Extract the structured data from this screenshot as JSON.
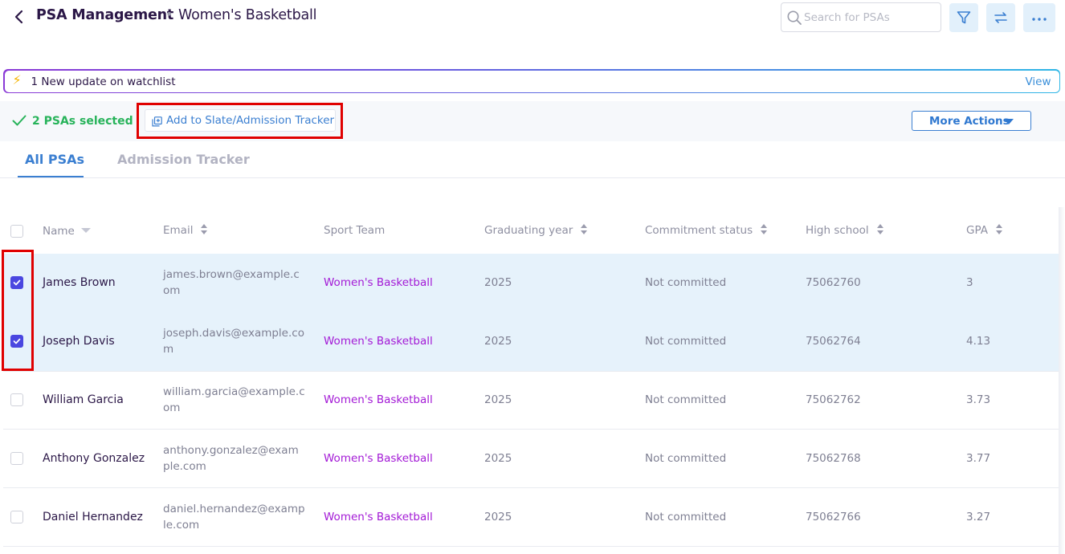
{
  "header": {
    "title": "PSA Management",
    "separator": "•",
    "subtitle": "Women's Basketball",
    "search_placeholder": "Search for PSAs",
    "actions": [
      "filter-icon",
      "swap-icon",
      "more-horizontal-icon"
    ]
  },
  "banner": {
    "icon": "lightning-icon",
    "text": "1 New update on watchlist",
    "view_label": "View"
  },
  "selection_bar": {
    "count_label": "2 PSAs selected",
    "add_button_label": "Add to Slate/Admission Tracker",
    "more_actions_label": "More Actions"
  },
  "tabs": [
    {
      "label": "All PSAs",
      "active": true
    },
    {
      "label": "Admission Tracker",
      "active": false
    }
  ],
  "table": {
    "columns": [
      "Name",
      "Email",
      "Sport Team",
      "Graduating year",
      "Commitment status",
      "High school",
      "GPA"
    ],
    "rows": [
      {
        "selected": true,
        "name": "James Brown",
        "email_line1": "james.brown@example.c",
        "email_line2": "om",
        "team": "Women's Basketball",
        "year": "2025",
        "status": "Not committed",
        "school": "75062760",
        "gpa": "3"
      },
      {
        "selected": true,
        "name": "Joseph Davis",
        "email_line1": "joseph.davis@example.co",
        "email_line2": "m",
        "team": "Women's Basketball",
        "year": "2025",
        "status": "Not committed",
        "school": "75062764",
        "gpa": "4.13"
      },
      {
        "selected": false,
        "name": "William Garcia",
        "email_line1": "william.garcia@example.c",
        "email_line2": "om",
        "team": "Women's Basketball",
        "year": "2025",
        "status": "Not committed",
        "school": "75062762",
        "gpa": "3.73"
      },
      {
        "selected": false,
        "name": "Anthony Gonzalez",
        "email_line1": "anthony.gonzalez@exam",
        "email_line2": "ple.com",
        "team": "Women's Basketball",
        "year": "2025",
        "status": "Not committed",
        "school": "75062768",
        "gpa": "3.77"
      },
      {
        "selected": false,
        "name": "Daniel Hernandez",
        "email_line1": "daniel.hernandez@examp",
        "email_line2": "le.com",
        "team": "Women's Basketball",
        "year": "2025",
        "status": "Not committed",
        "school": "75062766",
        "gpa": "3.27"
      }
    ]
  },
  "colors": {
    "accent": "#3b7fd1",
    "team_text": "#a319d6",
    "success": "#27b35a",
    "checkbox": "#4a47e0",
    "selected_row": "#e6f2fb",
    "annotation_red": "#e00000"
  }
}
